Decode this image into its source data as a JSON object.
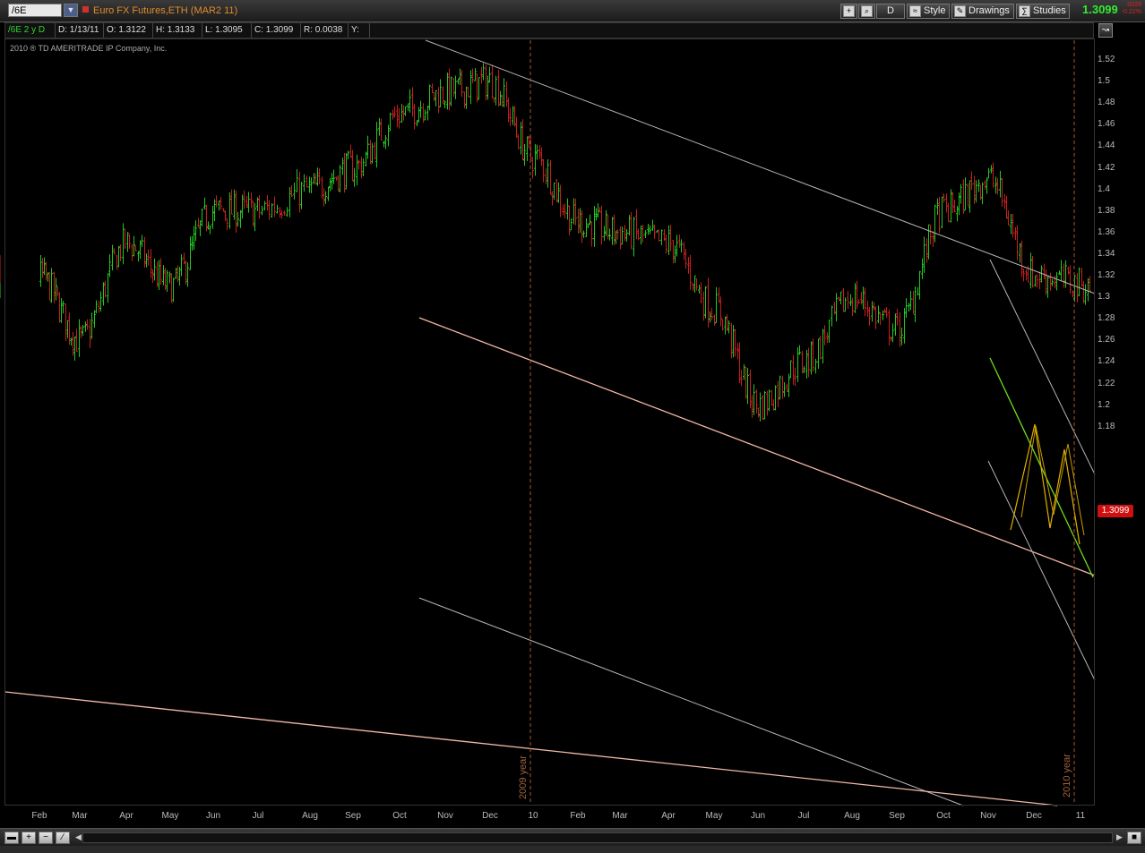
{
  "symbol": {
    "value": "/6E"
  },
  "chart_title": "Euro FX Futures,ETH (MAR2 11)",
  "toolbar": {
    "period_label": "D",
    "style_label": "Style",
    "drawings_label": "Drawings",
    "studies_label": "Studies",
    "last_price": "1.3099",
    "net_change": ".0029",
    "pct_change": "-0.22%"
  },
  "info_bar": [
    "/6E 2 y D",
    "D: 1/13/11",
    "O: 1.3122",
    "H: 1.3133",
    "L: 1.3095",
    "C: 1.3099",
    "R: 0.0038",
    "Y:"
  ],
  "copyright": "2010 ® TD AMERITRADE IP Company, Inc.",
  "price_tag": "1.3099",
  "year_markers": [
    "2009 year",
    "2010 year"
  ],
  "colors": {
    "up": "#22c822",
    "down": "#c81e1e",
    "channel_line": "#b5b5b5",
    "pink_line": "#f2b8a8",
    "yellow": "#e0b000",
    "green_line": "#6edc1e",
    "year_line": "#a05a30",
    "price_tag": "#d01010"
  },
  "chart_data": {
    "type": "candlestick-ohlc",
    "title": "Euro FX Futures,ETH (MAR2 11)",
    "xlabel": "",
    "ylabel": "",
    "ylim": [
      1.17,
      1.53
    ],
    "ytick_labels": [
      "1.52",
      "1.5",
      "1.48",
      "1.46",
      "1.44",
      "1.42",
      "1.4",
      "1.38",
      "1.36",
      "1.34",
      "1.32",
      "1.3",
      "1.28",
      "1.26",
      "1.24",
      "1.22",
      "1.2",
      "1.18"
    ],
    "xtick_labels": [
      "Feb",
      "Mar",
      "Apr",
      "May",
      "Jun",
      "Jul",
      "Aug",
      "Sep",
      "Oct",
      "Nov",
      "Dec",
      "10",
      "Feb",
      "Mar",
      "Apr",
      "May",
      "Jun",
      "Jul",
      "Aug",
      "Sep",
      "Oct",
      "Nov",
      "Dec",
      "11"
    ],
    "grid": false,
    "last_close": 1.3099,
    "path": {
      "months": [
        0,
        1,
        2,
        3,
        4,
        5,
        6,
        7,
        8,
        9,
        10,
        11,
        12,
        13,
        14,
        15,
        16,
        17,
        18,
        19,
        20,
        21,
        22,
        23.3
      ],
      "closes": [
        1.32,
        1.26,
        1.35,
        1.31,
        1.38,
        1.38,
        1.4,
        1.42,
        1.47,
        1.49,
        1.5,
        1.43,
        1.37,
        1.36,
        1.35,
        1.29,
        1.2,
        1.24,
        1.3,
        1.27,
        1.38,
        1.41,
        1.32,
        1.31
      ]
    }
  }
}
